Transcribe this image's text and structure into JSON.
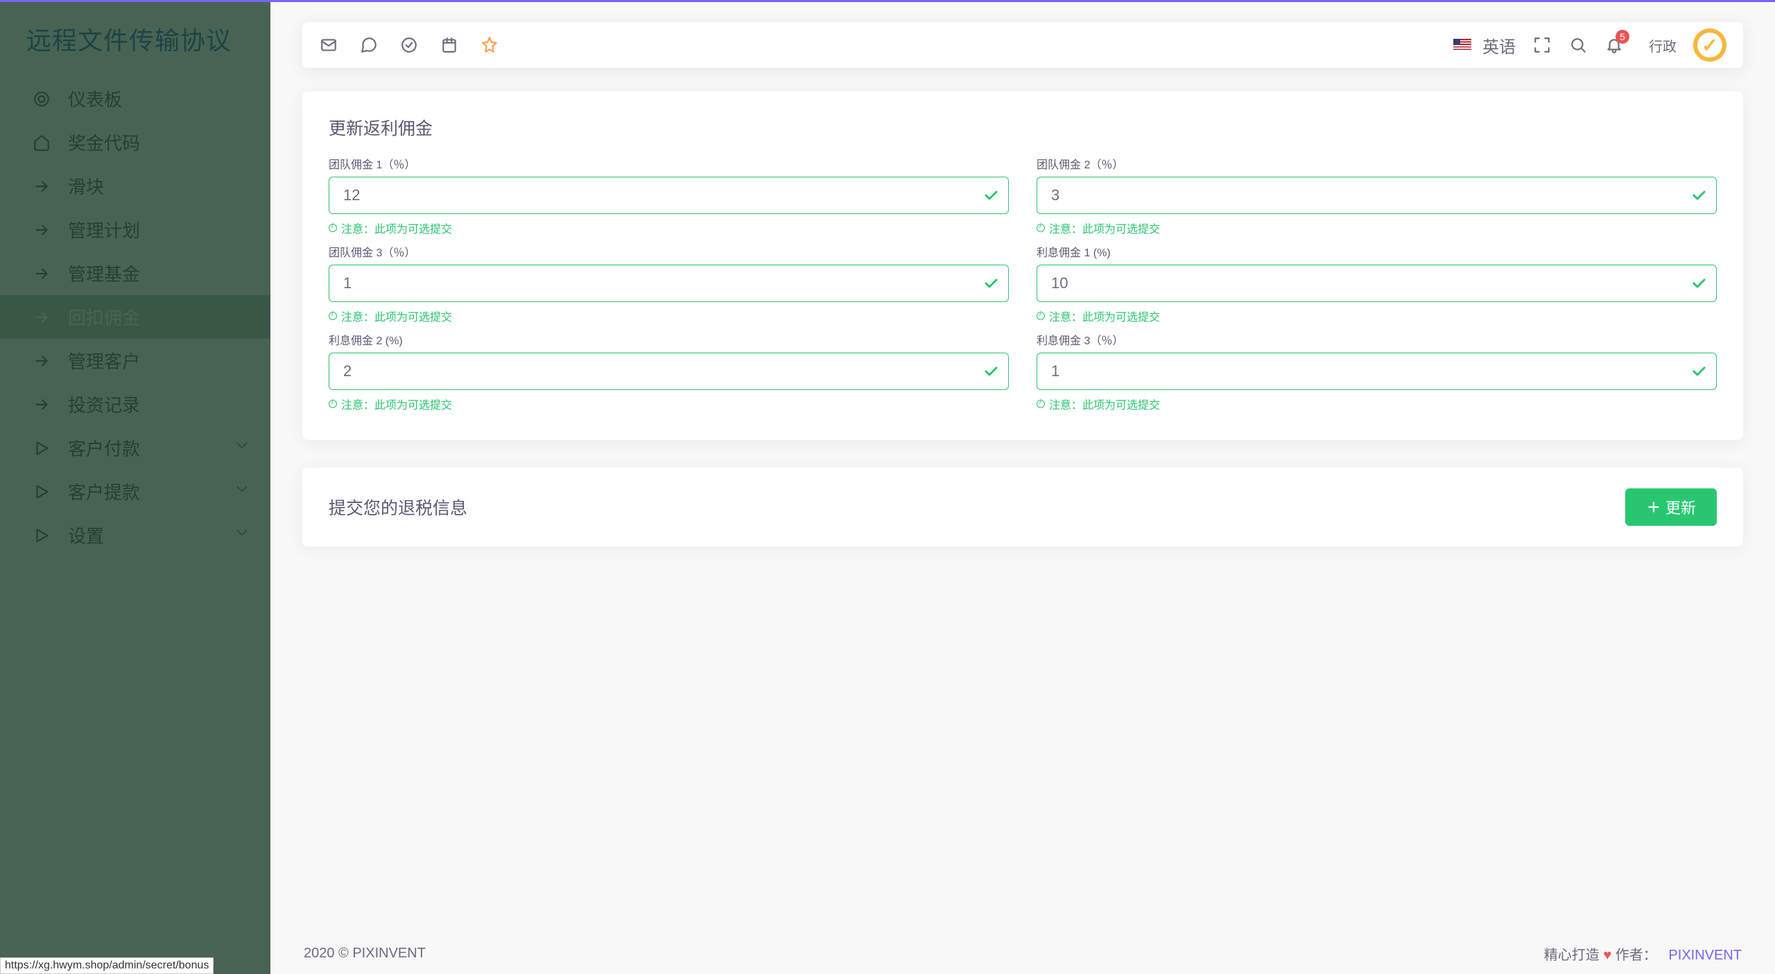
{
  "brand": "远程文件传输协议",
  "sidebar": {
    "items": [
      {
        "label": "仪表板",
        "icon": "target"
      },
      {
        "label": "奖金代码",
        "icon": "home"
      },
      {
        "label": "滑块",
        "icon": "arrow"
      },
      {
        "label": "管理计划",
        "icon": "arrow"
      },
      {
        "label": "管理基金",
        "icon": "arrow"
      },
      {
        "label": "回扣佣金",
        "icon": "arrow",
        "active": true
      },
      {
        "label": "管理客户",
        "icon": "arrow"
      },
      {
        "label": "投资记录",
        "icon": "arrow"
      },
      {
        "label": "客户付款",
        "icon": "play",
        "expandable": true
      },
      {
        "label": "客户提款",
        "icon": "play",
        "expandable": true
      },
      {
        "label": "设置",
        "icon": "play",
        "expandable": true
      }
    ]
  },
  "header": {
    "language": "英语",
    "badge": "5",
    "user": "行政"
  },
  "form": {
    "card_title": "更新返利佣金",
    "help": "注意：此项为可选提交",
    "fields": {
      "team1": {
        "label": "团队佣金 1（％）",
        "value": "12"
      },
      "team2": {
        "label": "团队佣金 2（％）",
        "value": "3"
      },
      "team3": {
        "label": "团队佣金 3（％）",
        "value": "1"
      },
      "int1": {
        "label": "利息佣金 1 (%)",
        "value": "10"
      },
      "int2": {
        "label": "利息佣金 2 (%)",
        "value": "2"
      },
      "int3": {
        "label": "利息佣金 3（％）",
        "value": "1"
      }
    },
    "submit_title": "提交您的退税信息",
    "submit_btn": "更新"
  },
  "footer": {
    "copyright": "2020 © PIXINVENT",
    "made": "精心打造",
    "author_label": "作者：",
    "author": "PIXINVENT"
  },
  "status_url": "https://xg.hwym.shop/admin/secret/bonus"
}
